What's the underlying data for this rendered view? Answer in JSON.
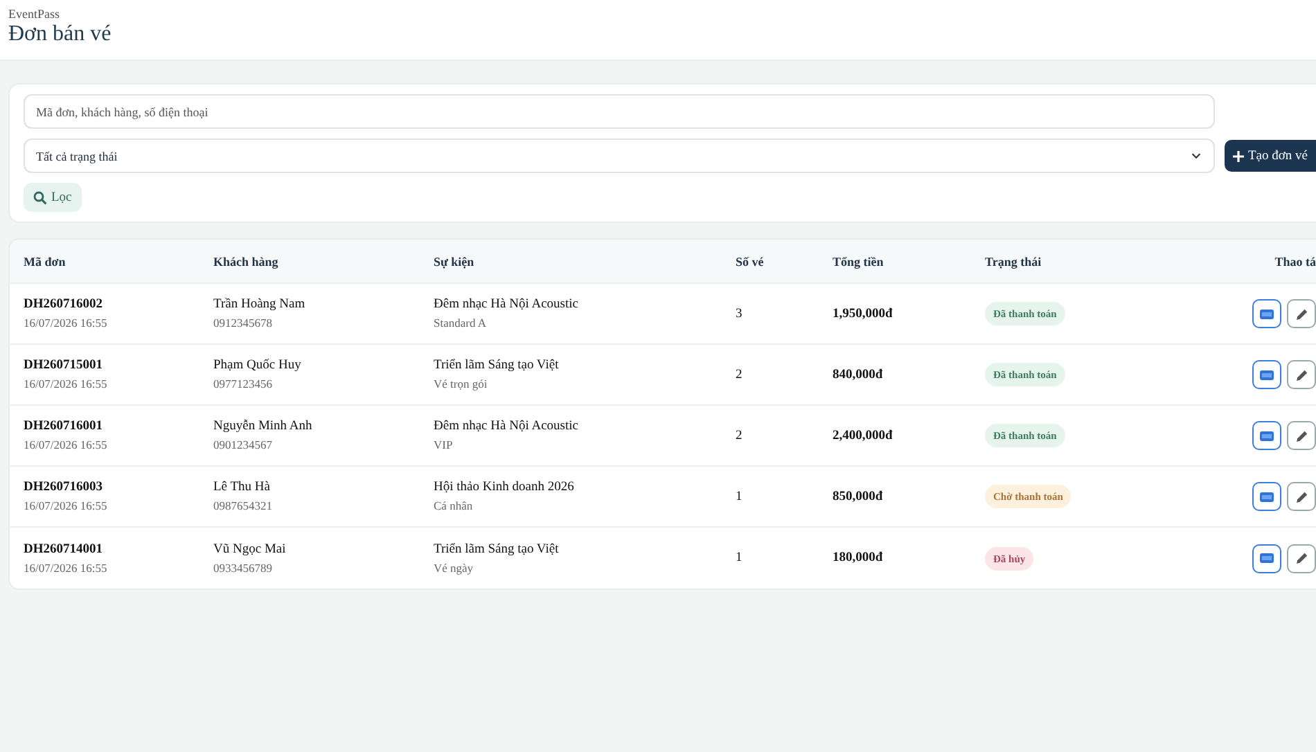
{
  "header": {
    "brand": "EventPass",
    "title": "Đơn bán vé"
  },
  "filters": {
    "search": {
      "placeholder": "Mã đơn, khách hàng, số điện thoại"
    },
    "status_select": {
      "value": "Tất cả trạng thái"
    },
    "filter_button": "Lọc",
    "create_button": "Tạo đơn vé"
  },
  "table": {
    "columns": [
      "Mã đơn",
      "Khách hàng",
      "Sự kiện",
      "Số vé",
      "Tổng tiền",
      "Trạng thái",
      "Thao tá"
    ],
    "rows": [
      {
        "order_id": "DH260716002",
        "date": "16/07/2026 16:55",
        "customer": "Trần Hoàng Nam",
        "phone": "0912345678",
        "event": "Đêm nhạc Hà Nội Acoustic",
        "ticket_type": "Standard A",
        "quantity": "3",
        "total": "1,950,000đ",
        "status": {
          "label": "Đã thanh toán",
          "kind": "paid"
        }
      },
      {
        "order_id": "DH260715001",
        "date": "16/07/2026 16:55",
        "customer": "Phạm Quốc Huy",
        "phone": "0977123456",
        "event": "Triển lãm Sáng tạo Việt",
        "ticket_type": "Vé trọn gói",
        "quantity": "2",
        "total": "840,000đ",
        "status": {
          "label": "Đã thanh toán",
          "kind": "paid"
        }
      },
      {
        "order_id": "DH260716001",
        "date": "16/07/2026 16:55",
        "customer": "Nguyễn Minh Anh",
        "phone": "0901234567",
        "event": "Đêm nhạc Hà Nội Acoustic",
        "ticket_type": "VIP",
        "quantity": "2",
        "total": "2,400,000đ",
        "status": {
          "label": "Đã thanh toán",
          "kind": "paid"
        }
      },
      {
        "order_id": "DH260716003",
        "date": "16/07/2026 16:55",
        "customer": "Lê Thu Hà",
        "phone": "0987654321",
        "event": "Hội thảo Kinh doanh 2026",
        "ticket_type": "Cá nhân",
        "quantity": "1",
        "total": "850,000đ",
        "status": {
          "label": "Chờ thanh toán",
          "kind": "pending"
        }
      },
      {
        "order_id": "DH260714001",
        "date": "16/07/2026 16:55",
        "customer": "Vũ Ngọc Mai",
        "phone": "0933456789",
        "event": "Triển lãm Sáng tạo Việt",
        "ticket_type": "Vé ngày",
        "quantity": "1",
        "total": "180,000đ",
        "status": {
          "label": "Đã hủy",
          "kind": "cancelled"
        }
      }
    ]
  }
}
